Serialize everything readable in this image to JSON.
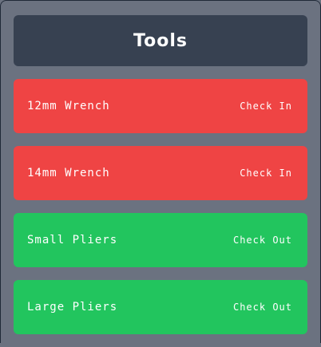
{
  "header": {
    "title": "Tools"
  },
  "colors": {
    "background": "#6b7280",
    "header": "#374151",
    "checked_out": "#ef4444",
    "available": "#22c55e",
    "text": "#ffffff"
  },
  "tools": [
    {
      "name": "12mm Wrench",
      "action": "Check In",
      "status": "checked_out"
    },
    {
      "name": "14mm Wrench",
      "action": "Check In",
      "status": "checked_out"
    },
    {
      "name": "Small Pliers",
      "action": "Check Out",
      "status": "available"
    },
    {
      "name": "Large Pliers",
      "action": "Check Out",
      "status": "available"
    }
  ]
}
